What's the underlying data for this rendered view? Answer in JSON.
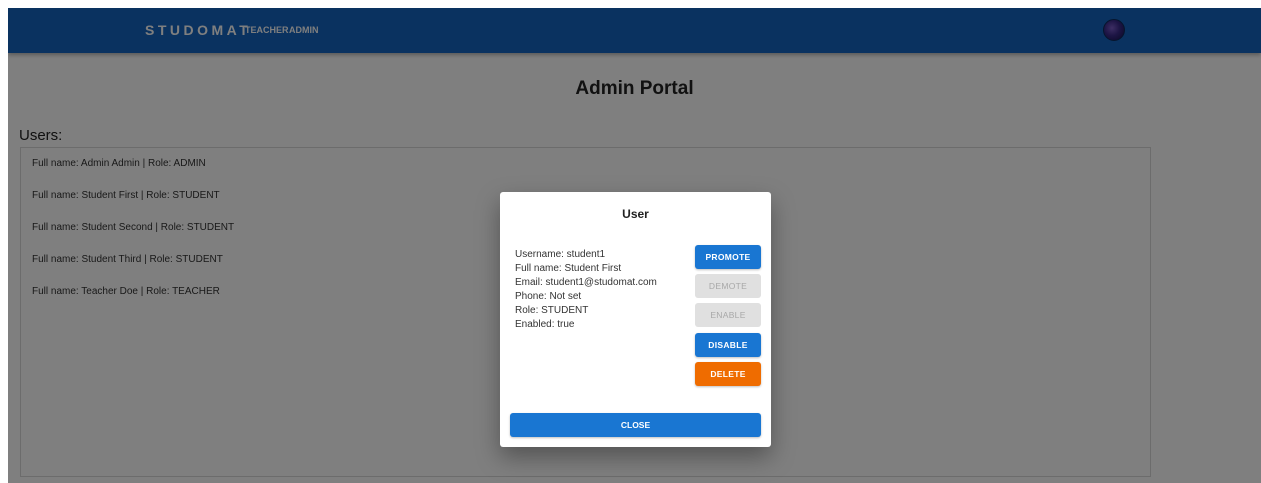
{
  "appbar": {
    "brand": "STUDOMAT",
    "nav": [
      "TEACHER",
      "ADMIN"
    ],
    "color": "#1565c0"
  },
  "page": {
    "title": "Admin Portal",
    "users_heading": "Users:"
  },
  "users": [
    "Full name: Admin Admin | Role: ADMIN",
    "Full name: Student First | Role: STUDENT",
    "Full name: Student Second | Role: STUDENT",
    "Full name: Student Third | Role: STUDENT",
    "Full name: Teacher Doe | Role: TEACHER"
  ],
  "dialog": {
    "title": "User",
    "info": [
      "Username: student1",
      "Full name: Student First",
      "Email: student1@studomat.com",
      "Phone: Not set",
      "Role: STUDENT",
      "Enabled: true"
    ],
    "buttons": {
      "promote": "PROMOTE",
      "demote": "DEMOTE",
      "enable": "ENABLE",
      "disable": "DISABLE",
      "delete": "DELETE",
      "close": "CLOSE"
    }
  },
  "colors": {
    "primary": "#1976d2",
    "danger": "#ef6c00",
    "disabled": "#e0e0e0"
  }
}
